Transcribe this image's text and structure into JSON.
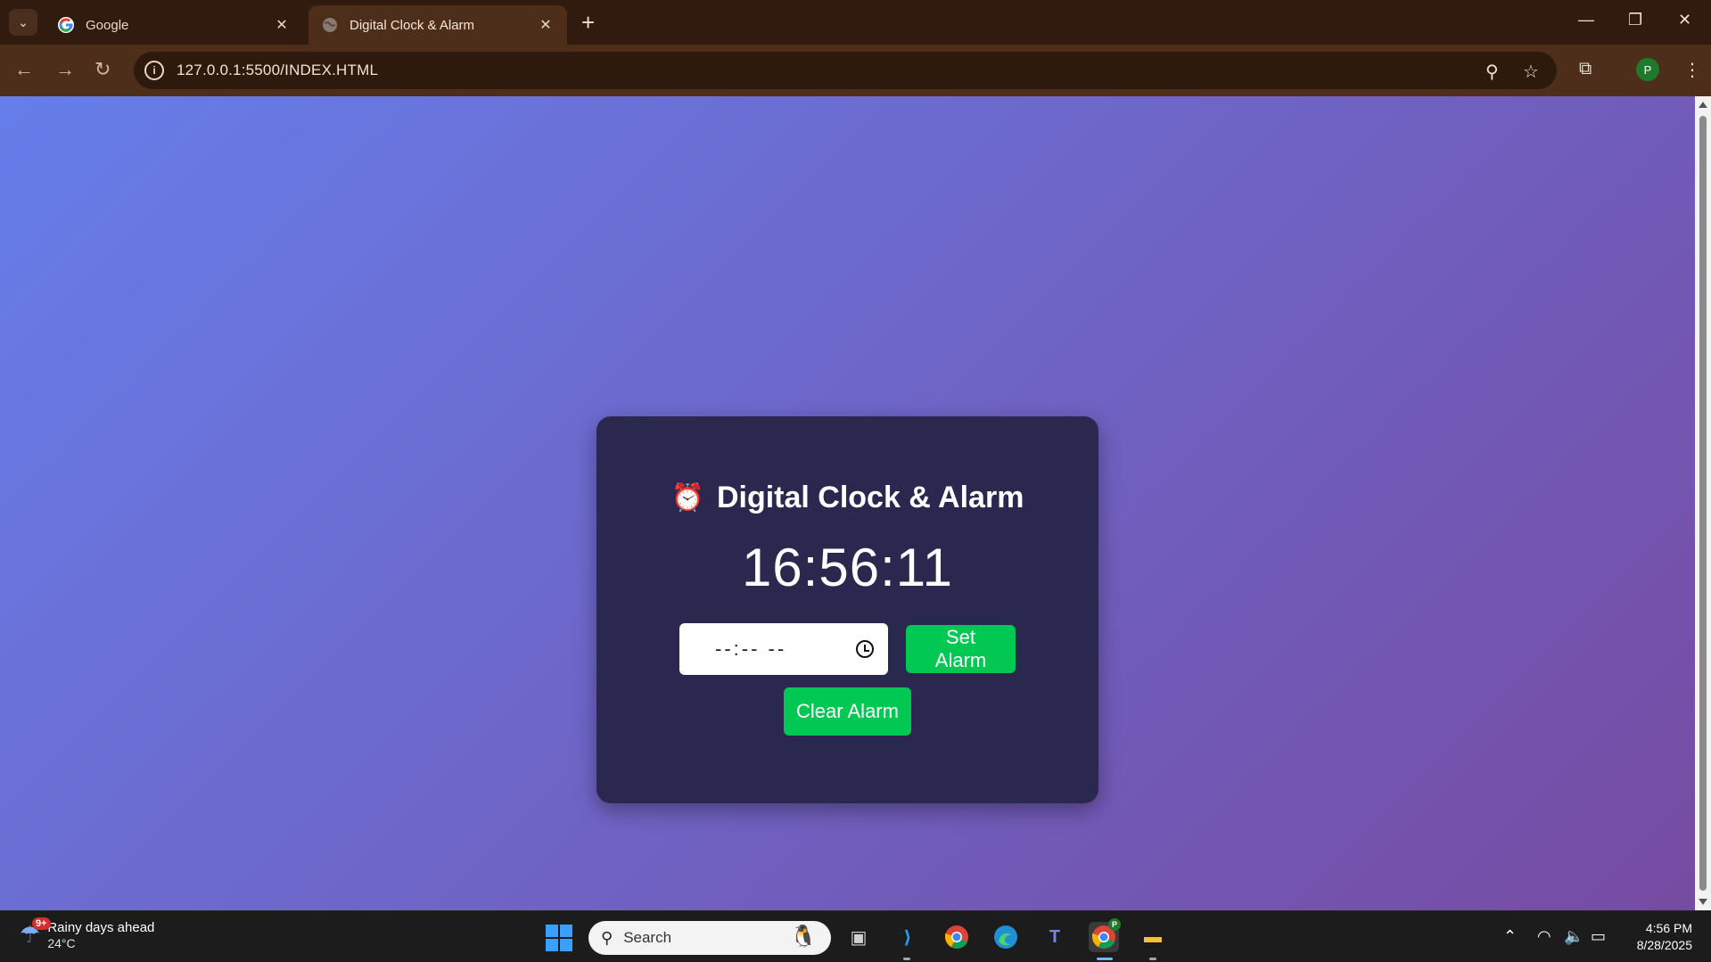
{
  "browser": {
    "tabs": [
      {
        "title": "Google",
        "favicon": "google-g-icon"
      },
      {
        "title": "Digital Clock & Alarm",
        "favicon": "globe-icon"
      }
    ],
    "tab_close_glyph": "✕",
    "new_tab_glyph": "+",
    "url": "127.0.0.1:5500/INDEX.HTML",
    "profile_initial": "P",
    "window_controls": {
      "minimize": "—",
      "restore": "❐",
      "close": "✕"
    }
  },
  "page": {
    "title": "Digital Clock & Alarm",
    "title_icon": "⏰",
    "clock": "16:56:11",
    "time_input_value": "--:-- --",
    "set_alarm_label": "Set Alarm",
    "clear_alarm_label": "Clear Alarm",
    "background_gradient": [
      "#667eea",
      "#764ba2"
    ],
    "card_color": "#2b2850",
    "button_color": "#00c853"
  },
  "taskbar": {
    "weather_badge": "9+",
    "weather_text": "Rainy days ahead",
    "weather_temp": "24°C",
    "search_label": "Search",
    "time": "4:56 PM",
    "date": "8/28/2025",
    "chrome_profile_badge": "P"
  }
}
